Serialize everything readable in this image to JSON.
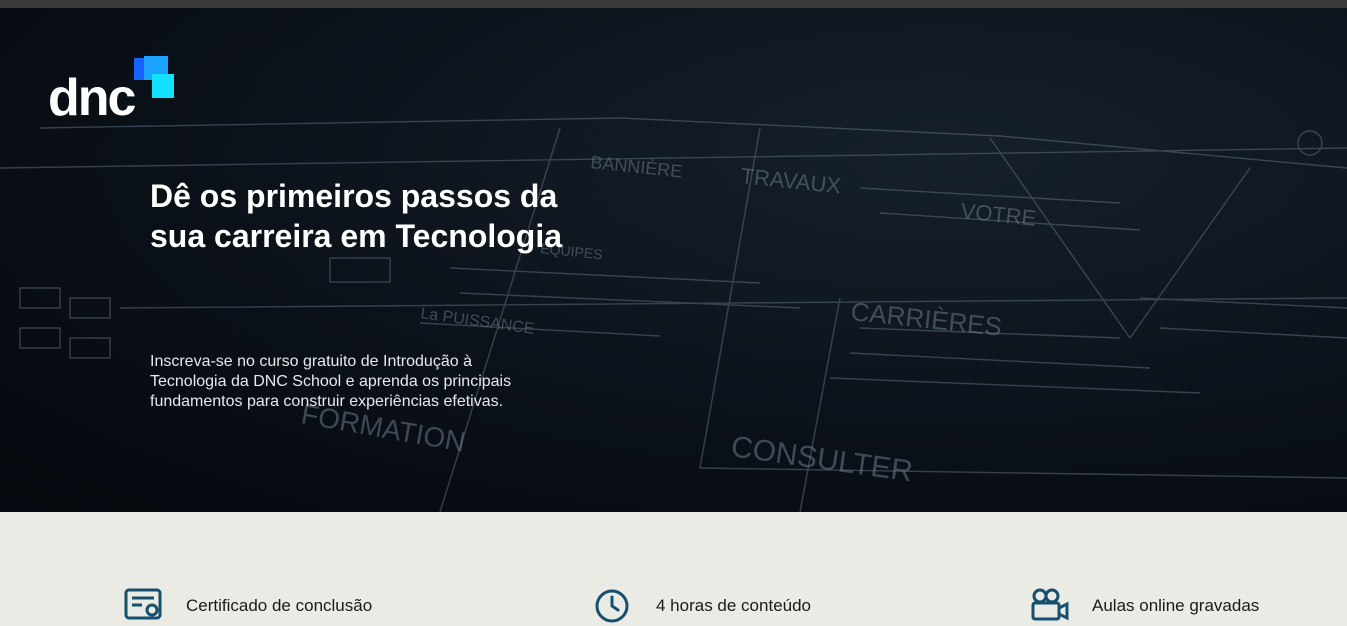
{
  "brand": {
    "logo_text": "dnc",
    "colors": {
      "blue": "#1663ff",
      "light_blue": "#1aa3ff",
      "cyan": "#14e0ff",
      "feature_icon": "#16506e"
    }
  },
  "hero": {
    "headline": "Dê os primeiros passos da sua carreira em Tecnologia",
    "description": "Inscreva-se no curso gratuito de Introdução à Tecnologia da DNC School e aprenda os principais fundamentos para construir experiências efetivas.",
    "background_sketch": {
      "words": [
        "CARRIÈRES",
        "CONSULTER",
        "FORMATION",
        "La PUISSANCE",
        "BANNIÈRE",
        "TRAVAUX",
        "ÉQUIPES",
        "VOTRE"
      ]
    }
  },
  "features": [
    {
      "icon": "certificate-icon",
      "label": "Certificado de conclusão"
    },
    {
      "icon": "clock-icon",
      "label": "4 horas de conteúdo"
    },
    {
      "icon": "video-camera-icon",
      "label": "Aulas online gravadas"
    }
  ]
}
